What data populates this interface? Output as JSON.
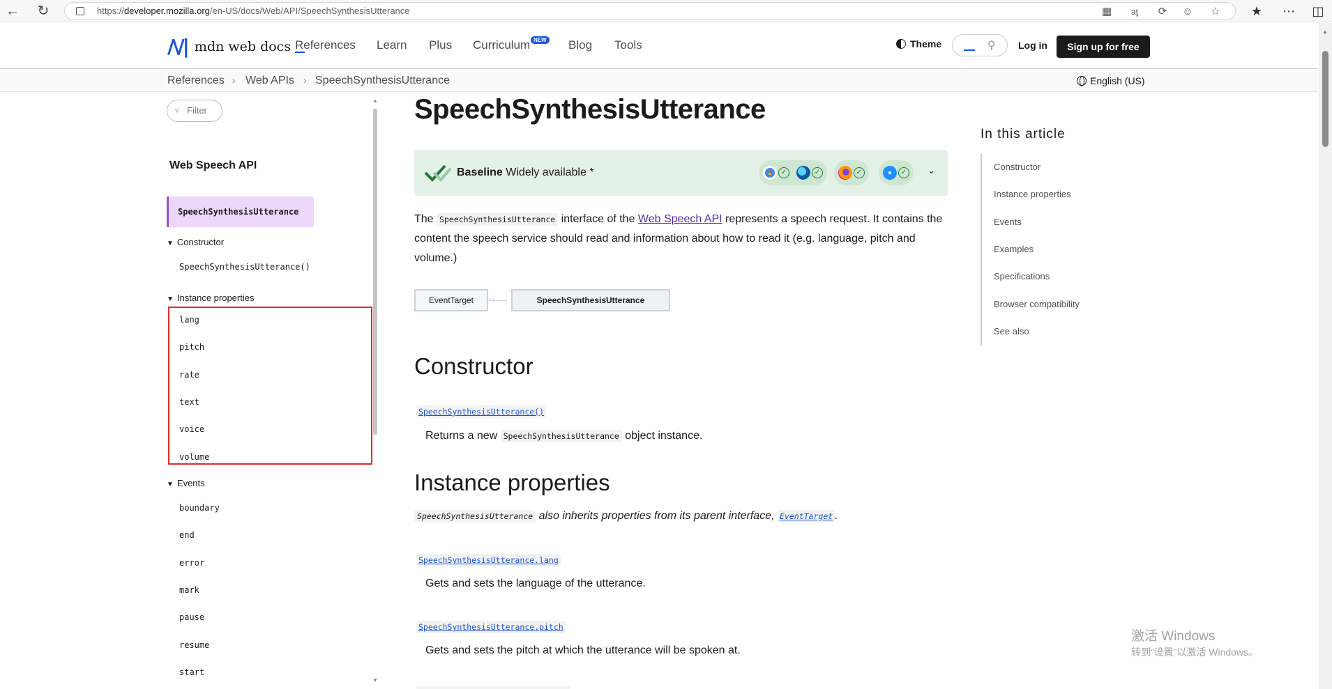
{
  "browser": {
    "url_prefix": "https://",
    "url_domain": "developer.mozilla.org",
    "url_path": "/en-US/docs/Web/API/SpeechSynthesisUtterance"
  },
  "header": {
    "logo_text": "mdn web docs",
    "nav": [
      "References",
      "Learn",
      "Plus",
      "Curriculum",
      "Blog",
      "Tools"
    ],
    "new_badge": "NEW",
    "theme_label": "Theme",
    "login_label": "Log in",
    "signup_label": "Sign up for free"
  },
  "breadcrumb": {
    "items": [
      "References",
      "Web APIs",
      "SpeechSynthesisUtterance"
    ],
    "language": "English (US)"
  },
  "sidebar": {
    "filter_placeholder": "Filter",
    "title": "Web Speech API",
    "active_item": "SpeechSynthesisUtterance",
    "sections": {
      "constructor": {
        "label": "Constructor",
        "items": [
          "SpeechSynthesisUtterance()"
        ]
      },
      "instance_properties": {
        "label": "Instance properties",
        "items": [
          "lang",
          "pitch",
          "rate",
          "text",
          "voice",
          "volume"
        ]
      },
      "events": {
        "label": "Events",
        "items": [
          "boundary",
          "end",
          "error",
          "mark",
          "pause",
          "resume",
          "start"
        ]
      }
    }
  },
  "article": {
    "title": "SpeechSynthesisUtterance",
    "baseline": {
      "label": "Baseline",
      "status": "Widely available *"
    },
    "intro": {
      "before": "The ",
      "code": "SpeechSynthesisUtterance",
      "middle": " interface of the ",
      "link": "Web Speech API",
      "after": " represents a speech request. It contains the content the speech service should read and information about how to read it (e.g. language, pitch and volume.)"
    },
    "inheritance": {
      "parent": "EventTarget",
      "child": "SpeechSynthesisUtterance"
    },
    "constructor_heading": "Constructor",
    "constructor_item": {
      "name": "SpeechSynthesisUtterance()",
      "desc_before": "Returns a new ",
      "desc_code": "SpeechSynthesisUtterance",
      "desc_after": " object instance."
    },
    "props_heading": "Instance properties",
    "props_inherit": {
      "code": "SpeechSynthesisUtterance",
      "text": " also inherits properties from its parent interface, ",
      "link": "EventTarget",
      "end": "."
    },
    "props": [
      {
        "name": "SpeechSynthesisUtterance.lang",
        "desc": "Gets and sets the language of the utterance."
      },
      {
        "name": "SpeechSynthesisUtterance.pitch",
        "desc": "Gets and sets the pitch at which the utterance will be spoken at."
      }
    ]
  },
  "toc": {
    "title": "In this article",
    "items": [
      "Constructor",
      "Instance properties",
      "Events",
      "Examples",
      "Specifications",
      "Browser compatibility",
      "See also"
    ]
  },
  "watermark": {
    "line1": "激活 Windows",
    "line2": "转到“设置”以激活 Windows。"
  },
  "colors": {
    "accent": "#1a54d9",
    "active_sidebar_bg": "#ecd8fb",
    "active_sidebar_border": "#9250d4",
    "baseline_bg": "#e4f1e6",
    "highlight_box": "#e32b2b"
  },
  "icons": [
    "back-icon",
    "reload-icon",
    "lock-icon",
    "search-icon",
    "globe-icon",
    "filter-icon",
    "chevron-down-icon"
  ]
}
